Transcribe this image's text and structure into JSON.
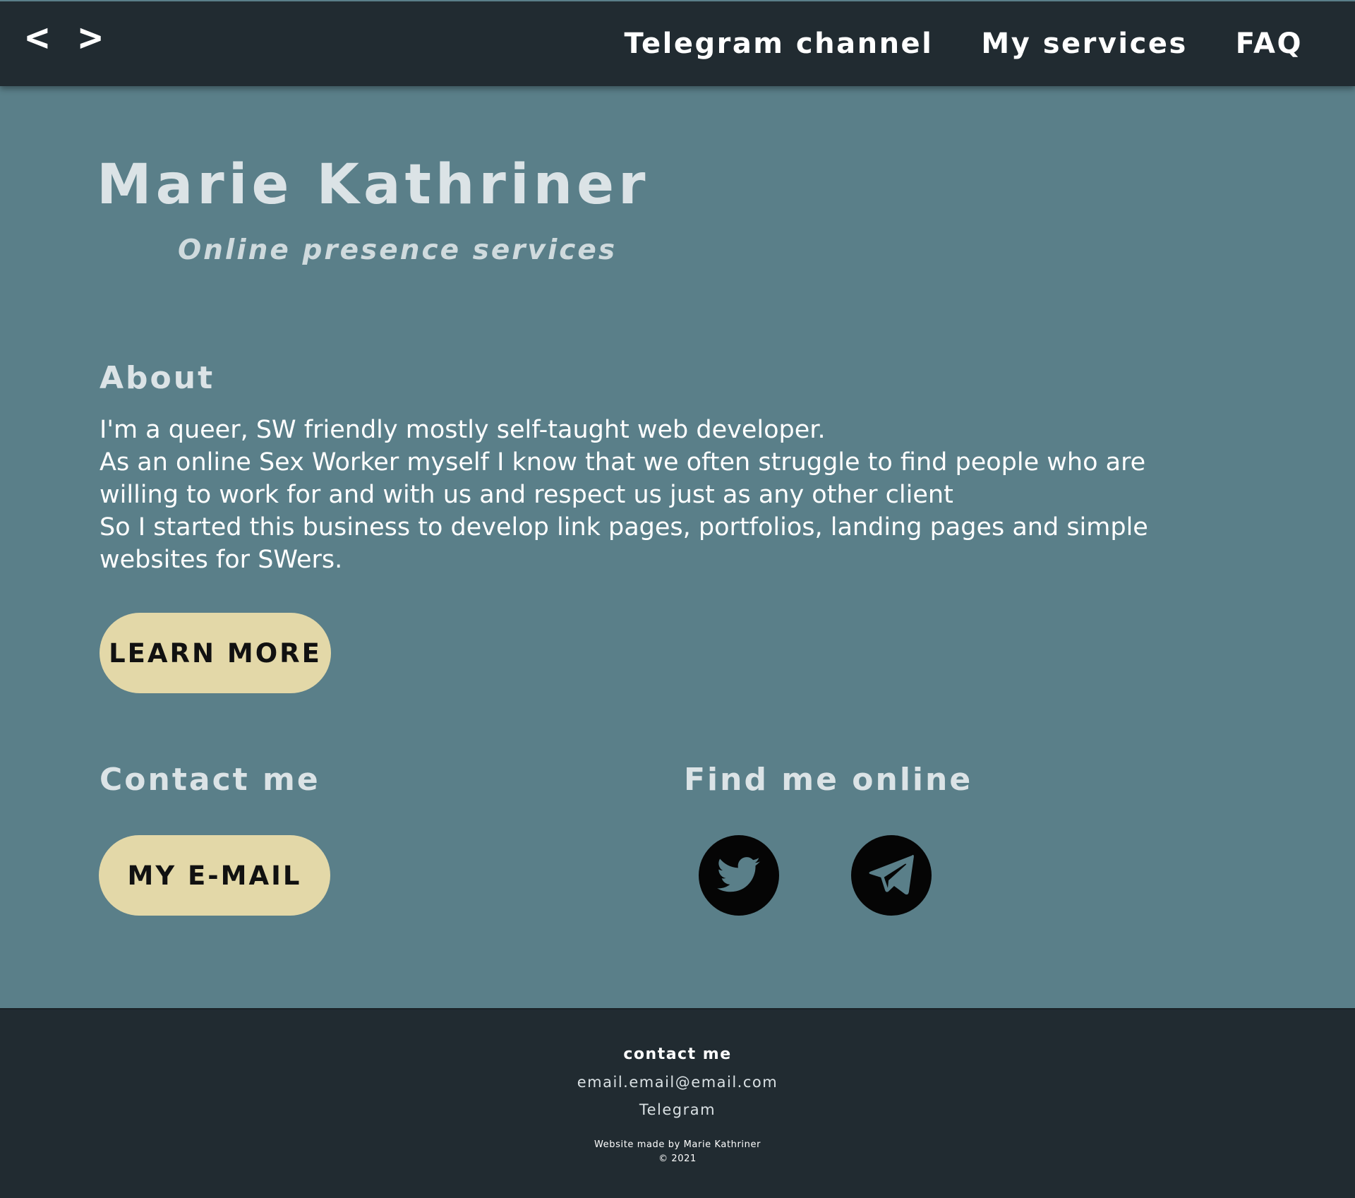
{
  "header": {
    "logo": "< >",
    "nav": [
      {
        "label": "Telegram channel"
      },
      {
        "label": "My services"
      },
      {
        "label": "FAQ"
      }
    ]
  },
  "hero": {
    "title": "Marie Kathriner",
    "subtitle": "Online presence services"
  },
  "about": {
    "title": "About",
    "paragraphs": [
      "I'm a queer, SW friendly mostly self-taught web developer.",
      "As an online Sex Worker myself I know that we often struggle to find people who are willing to work for and with us and respect us just as any other client",
      "So I started this business to develop link pages, portfolios, landing pages and simple websites for SWers."
    ],
    "button_label": "LEARN MORE"
  },
  "contact": {
    "title": "Contact me",
    "button_label": "MY E-MAIL"
  },
  "find_online": {
    "title": "Find me online",
    "icons": [
      "twitter-icon",
      "telegram-icon"
    ]
  },
  "footer": {
    "heading": "contact me",
    "email": "email.email@email.com",
    "telegram": "Telegram",
    "credit": "Website made by Marie Kathriner",
    "copyright": "© 2021"
  },
  "colors": {
    "page_background": "#5a7f89",
    "bar_background": "#212b31",
    "button_background": "#e3d8a8",
    "social_circle": "#050505"
  }
}
